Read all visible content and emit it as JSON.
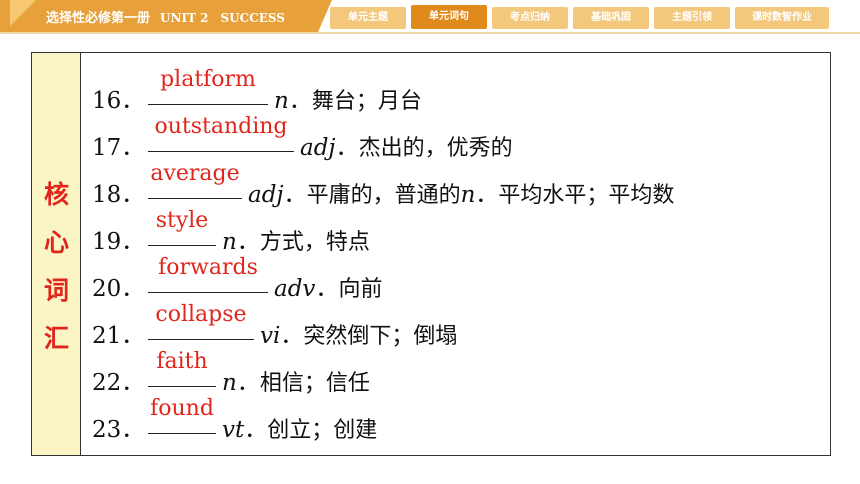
{
  "header": {
    "book": "选择性必修第一册",
    "unit": "UNIT 2　SUCCESS",
    "nav": [
      {
        "label": "单元主题",
        "active": false
      },
      {
        "label": "单元词句",
        "active": true
      },
      {
        "label": "考点归纳",
        "active": false
      },
      {
        "label": "基础巩固",
        "active": false
      },
      {
        "label": "主题引领",
        "active": false
      },
      {
        "label": "课时数智作业",
        "active": false
      }
    ]
  },
  "side_label": [
    "核",
    "心",
    "词",
    "汇"
  ],
  "colors": {
    "accent": "#e8a13a",
    "active_tab": "#e08a1b",
    "answer": "#e0261c",
    "side_bg": "#fbf4c4"
  },
  "items": [
    {
      "num": "16．",
      "answer": "platform",
      "pos": "n",
      "sep": "．",
      "meaning": "舞台；月台"
    },
    {
      "num": "17．",
      "answer": "outstanding",
      "pos": "adj",
      "sep": "．",
      "meaning": "杰出的，优秀的"
    },
    {
      "num": "18．",
      "answer": "average",
      "pos": "adj",
      "sep": "．",
      "meaning": "平庸的，普通的",
      "pos2": "n",
      "meaning2": "平均水平；平均数"
    },
    {
      "num": "19．",
      "answer": "style",
      "pos": "n",
      "sep": "．",
      "meaning": "方式，特点"
    },
    {
      "num": "20．",
      "answer": "forwards",
      "pos": "adv",
      "sep": "．",
      "meaning": "向前"
    },
    {
      "num": "21．",
      "answer": "collapse",
      "pos": "vi",
      "sep": "．",
      "meaning": "突然倒下；倒塌"
    },
    {
      "num": "22．",
      "answer": "faith",
      "pos": "n",
      "sep": "．",
      "meaning": "相信；信任"
    },
    {
      "num": "23．",
      "answer": "found",
      "pos": "vt",
      "sep": "．",
      "meaning": "创立；创建"
    }
  ]
}
